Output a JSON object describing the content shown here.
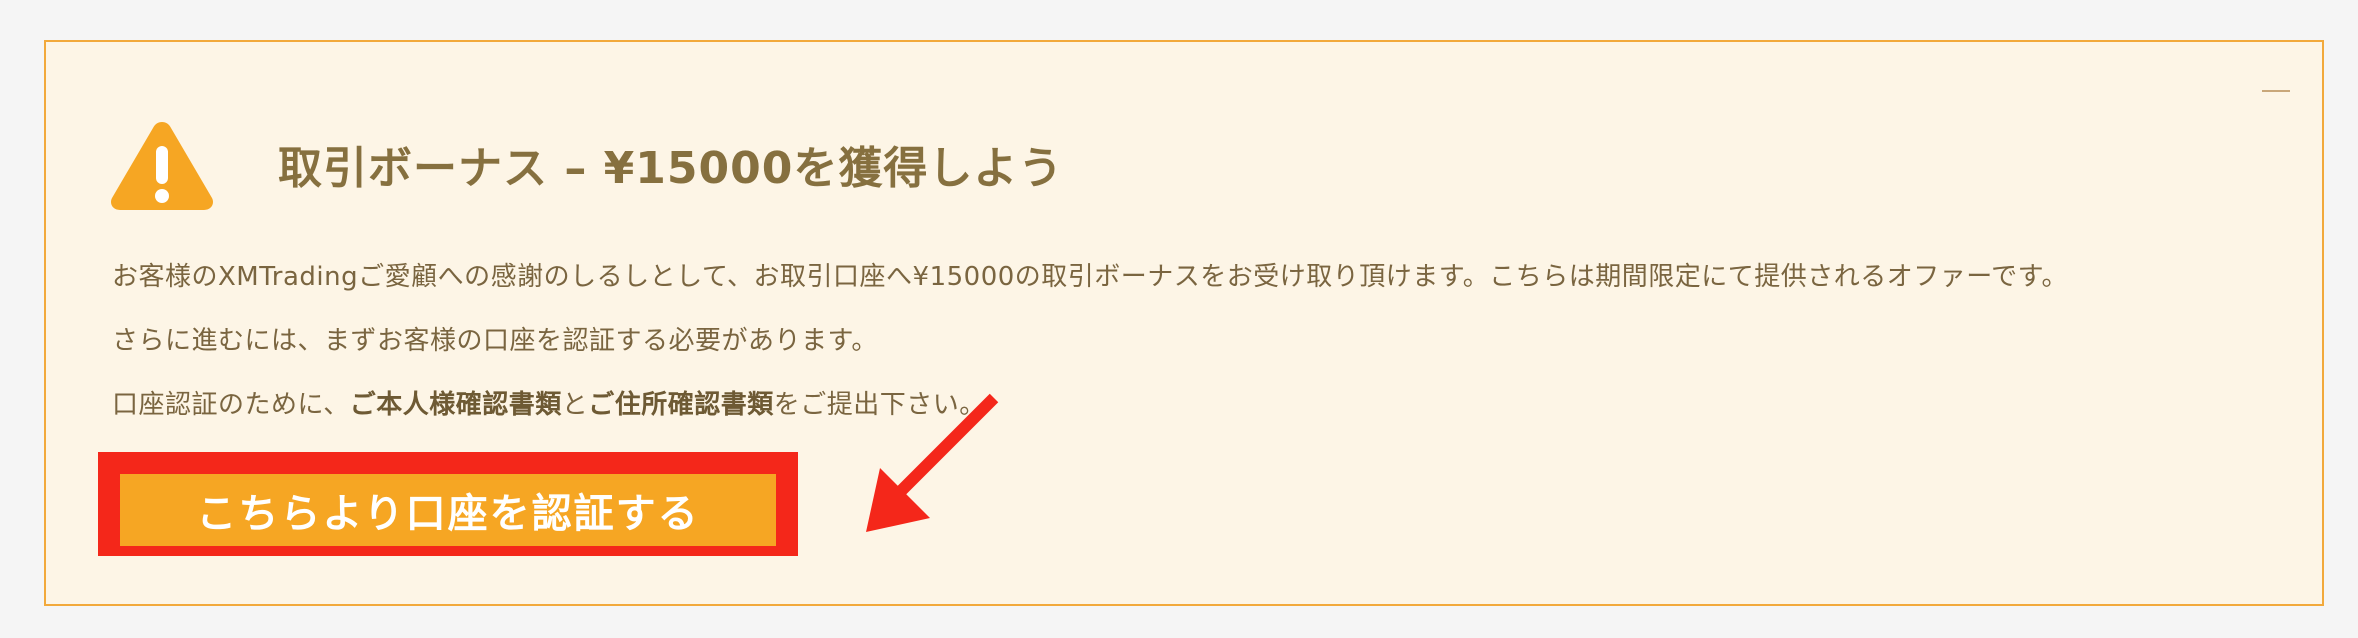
{
  "notice": {
    "title": "取引ボーナス – ¥15000を獲得しよう",
    "paragraph1": "お客様のXMTradingご愛顧への感謝のしるしとして、お取引口座へ¥15000の取引ボーナスをお受け取り頂けます。こちらは期間限定にて提供されるオファーです。",
    "paragraph2": "さらに進むには、まずお客様の口座を認証する必要があります。",
    "paragraph3": {
      "prefix": "口座認証のために、",
      "bold1": "ご本人様確認書類",
      "middle": "と",
      "bold2": "ご住所確認書類",
      "suffix": "をご提出下さい。"
    },
    "button_label": "こちらより口座を認証する",
    "icons": {
      "warning": "warning-icon",
      "minimize": "minimize-icon"
    }
  },
  "colors": {
    "panel_background": "#fdf5e6",
    "panel_border": "#f2a93b",
    "accent_orange": "#f6a623",
    "highlight_red": "#f4271a",
    "text_brown": "#7a6540"
  }
}
